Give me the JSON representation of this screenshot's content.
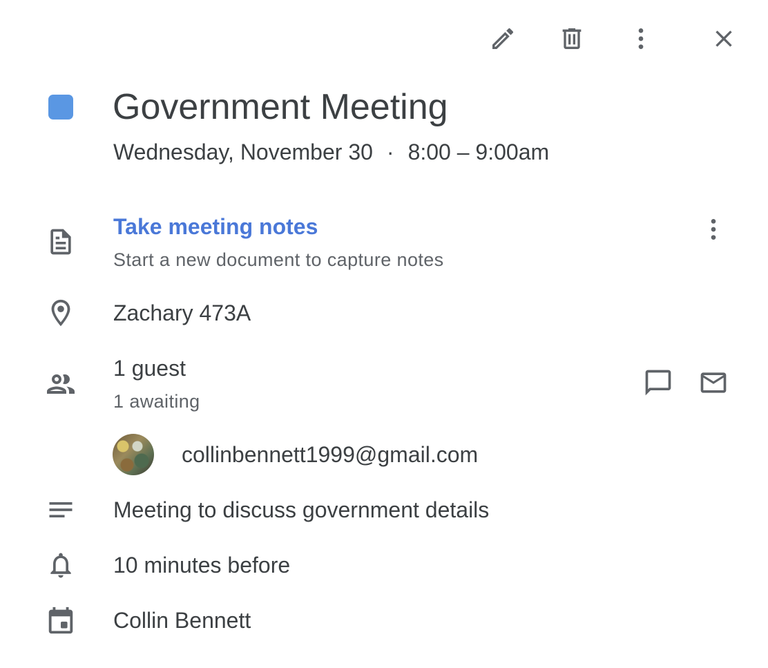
{
  "toolbar": {
    "edit_icon": "pencil-icon",
    "delete_icon": "trash-icon",
    "more_icon": "more-vert-icon",
    "close_icon": "close-icon"
  },
  "event": {
    "color": "#5a97e3",
    "title": "Government Meeting",
    "date": "Wednesday, November 30",
    "separator": "·",
    "time": "8:00 – 9:00am"
  },
  "notes": {
    "link_label": "Take meeting notes",
    "subtitle": "Start a new document to capture notes"
  },
  "location": "Zachary 473A",
  "guests": {
    "count_label": "1 guest",
    "status_label": "1 awaiting",
    "list": [
      {
        "email": "collinbennett1999@gmail.com"
      }
    ]
  },
  "description": "Meeting to discuss government details",
  "reminder": "10 minutes before",
  "calendar_owner": "Collin Bennett"
}
